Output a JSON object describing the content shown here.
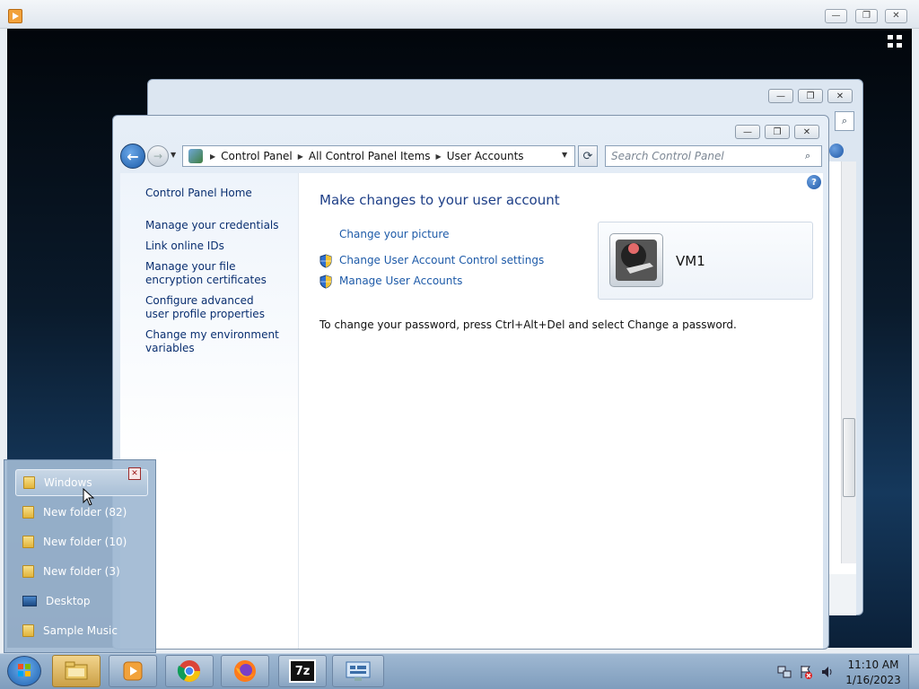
{
  "host": {
    "min_symbol": "—",
    "max_symbol": "❐",
    "close_symbol": "✕",
    "fullscreen_symbol": "⇲"
  },
  "back_window": {
    "min_symbol": "—",
    "max_symbol": "❐",
    "close_symbol": "✕"
  },
  "window": {
    "min_symbol": "—",
    "max_symbol": "❐",
    "close_symbol": "✕"
  },
  "address_bar": {
    "crumbs": [
      "Control Panel",
      "All Control Panel Items",
      "User Accounts"
    ],
    "separator": "▶",
    "dropdown": "▼"
  },
  "search": {
    "placeholder": "Search Control Panel",
    "icon": "search-icon"
  },
  "left_pane": {
    "home": "Control Panel Home",
    "links": [
      "Manage your credentials",
      "Link online IDs",
      "Manage your file encryption certificates",
      "Configure advanced user profile properties",
      "Change my environment variables"
    ]
  },
  "main": {
    "heading": "Make changes to your user account",
    "actions": [
      "Change your picture",
      "Change User Account Control settings",
      "Manage User Accounts"
    ],
    "password_note": "To change your password, press Ctrl+Alt+Del and select Change a password."
  },
  "user": {
    "name": "VM1"
  },
  "jump_list": {
    "items": [
      "Windows",
      "New folder (82)",
      "New folder (10)",
      "New folder (3)",
      "Desktop",
      "Sample Music"
    ],
    "close_symbol": "✕"
  },
  "taskbar": {
    "apps": [
      "explorer-icon",
      "media-player-icon",
      "chrome-icon",
      "firefox-icon",
      "7zip-icon",
      "control-panel-icon"
    ],
    "seven_zip_label": "7z",
    "tray": [
      "network-icon",
      "action-center-icon",
      "volume-icon"
    ]
  },
  "clock": {
    "time": "11:10 AM",
    "date": "1/16/2023"
  },
  "colors": {
    "link": "#0a2f70",
    "heading": "#1e3f87",
    "taskbar": "#8ea9c6"
  }
}
